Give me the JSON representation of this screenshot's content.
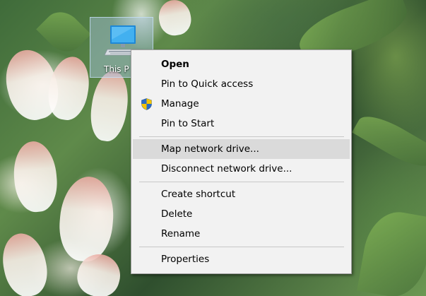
{
  "desktop": {
    "icon": {
      "label": "This P",
      "icon_name": "computer-monitor-icon"
    }
  },
  "context_menu": {
    "items": [
      {
        "label": "Open",
        "bold": true
      },
      {
        "label": "Pin to Quick access"
      },
      {
        "label": "Manage",
        "icon": "uac-shield-icon"
      },
      {
        "label": "Pin to Start"
      },
      {
        "label": "Map network drive...",
        "highlighted": true
      },
      {
        "label": "Disconnect network drive..."
      },
      {
        "label": "Create shortcut"
      },
      {
        "label": "Delete"
      },
      {
        "label": "Rename"
      },
      {
        "label": "Properties"
      }
    ]
  },
  "colors": {
    "menu_background": "#f2f2f2",
    "menu_highlight": "#dadada",
    "icon_selection": "#aac8e6",
    "shield_blue": "#2b6cc4",
    "shield_yellow": "#f4c400"
  }
}
